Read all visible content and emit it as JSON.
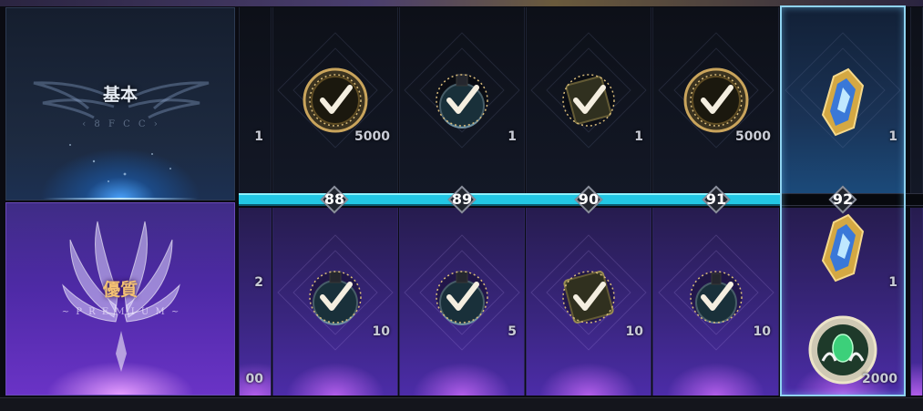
{
  "tiers": {
    "basic": {
      "label": "基本",
      "subtitle_glyphs": "<8ℱℭℭ>"
    },
    "premium": {
      "label": "優質",
      "subtitle_glyphs": "ℯℯℴℳℐℴℯ"
    }
  },
  "partial_column": {
    "basic_qty": "1",
    "premium_qty": "2",
    "premium_qty_lower": "00"
  },
  "levels": [
    {
      "level": "88",
      "basic": {
        "item": "coin-icon",
        "qty": "5000",
        "claimed": true
      },
      "premium": {
        "item": "potion-icon",
        "qty": "10",
        "claimed": true
      }
    },
    {
      "level": "89",
      "basic": {
        "item": "potion-icon",
        "qty": "1",
        "claimed": true
      },
      "premium": {
        "item": "potion-icon",
        "qty": "5",
        "claimed": true
      }
    },
    {
      "level": "90",
      "basic": {
        "item": "scroll-icon",
        "qty": "1",
        "claimed": true
      },
      "premium": {
        "item": "scroll-icon",
        "qty": "10",
        "claimed": true
      }
    },
    {
      "level": "91",
      "basic": {
        "item": "coin-icon",
        "qty": "5000",
        "claimed": true
      },
      "premium": {
        "item": "potion-icon",
        "qty": "10",
        "claimed": true
      }
    },
    {
      "level": "92",
      "basic": {
        "item": "crystal-icon",
        "qty": "1",
        "claimed": false
      },
      "premium": [
        {
          "item": "crystal-icon",
          "qty": "1",
          "claimed": false
        },
        {
          "item": "emerald-coin-icon",
          "qty": "2000",
          "claimed": false
        }
      ]
    }
  ],
  "progress": {
    "reached_level": "91",
    "current_level": "92"
  },
  "colors": {
    "track": "#22c7e4",
    "premium_label": "#f3c173",
    "selected_border": "#8fd3f0"
  }
}
